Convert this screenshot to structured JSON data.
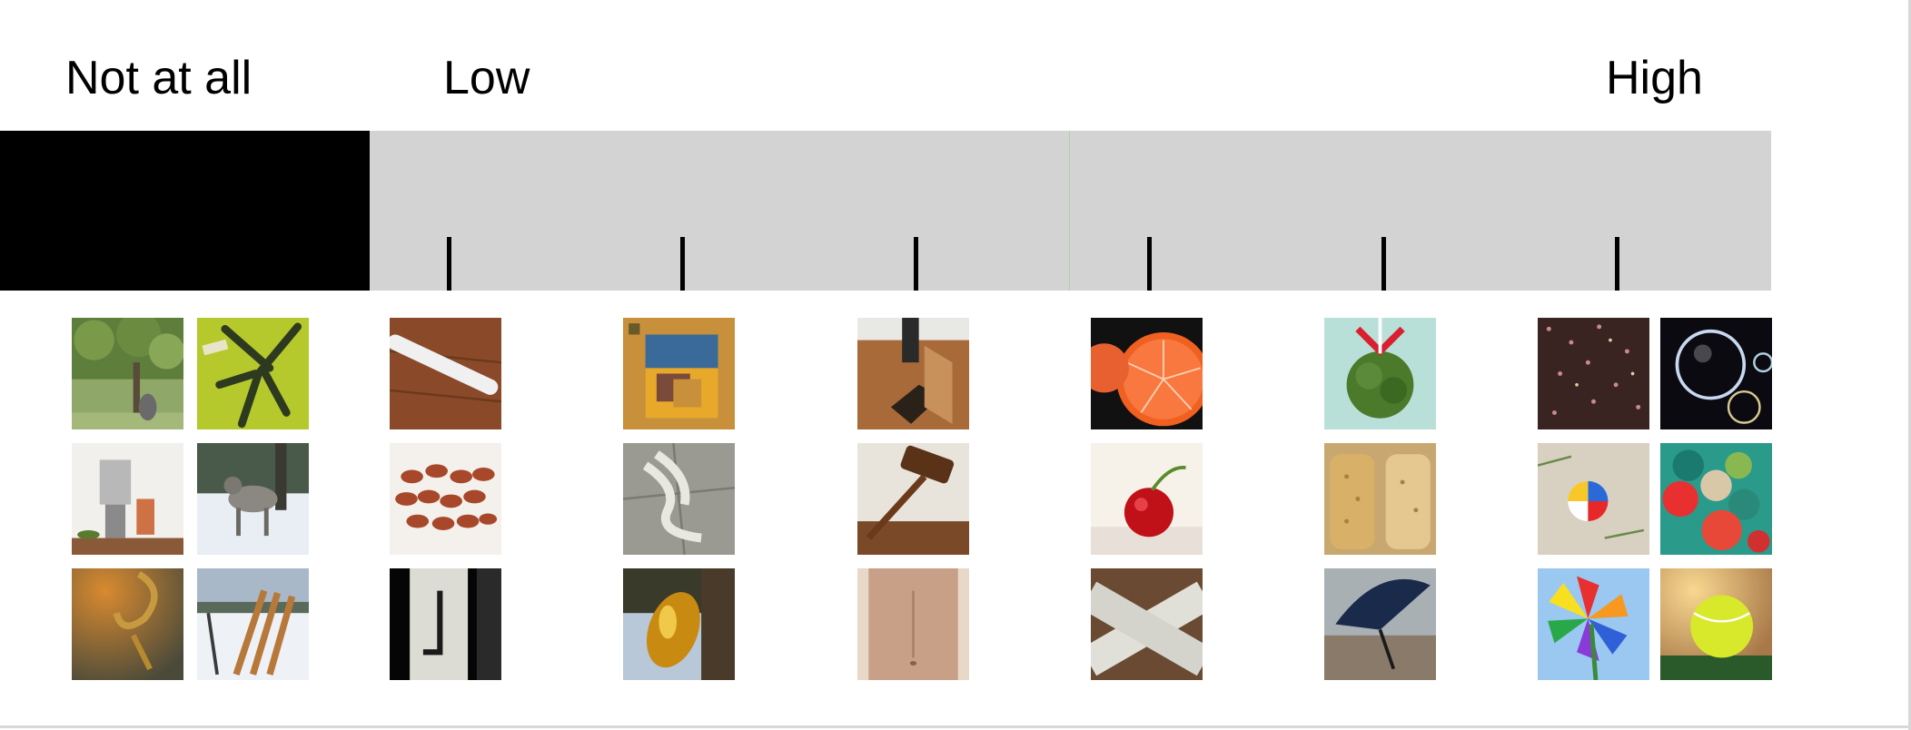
{
  "scale": {
    "labels": {
      "not_at_all": "Not at all",
      "low": "Low",
      "high": "High"
    },
    "tick_count": 6,
    "colors": {
      "not_at_all_box": "#000000",
      "bar": "#d3d3d3",
      "midline": "#a8d8a8"
    }
  },
  "images": {
    "not_at_all": [
      "tree-with-statue-image",
      "green-pens-image",
      "juicer-kitchen-image",
      "wolf-in-snow-image",
      "golden-hook-image",
      "hockey-sticks-image"
    ],
    "level_1": [
      "white-marker-image",
      "pecans-image",
      "door-latch-image"
    ],
    "level_2": [
      "puzzle-image",
      "tied-rope-on-tile-image",
      "amber-stone-image"
    ],
    "level_3": [
      "floor-hatch-image",
      "gavel-image",
      "torso-image"
    ],
    "level_4": [
      "grapefruit-image",
      "cherry-image",
      "velcro-straps-image"
    ],
    "level_5": [
      "mistletoe-image",
      "crackers-image",
      "umbrella-image"
    ],
    "high": [
      "glitter-image",
      "soap-bubbles-image",
      "beach-ball-image",
      "pom-poms-image",
      "pinwheel-image",
      "tennis-ball-image"
    ]
  }
}
